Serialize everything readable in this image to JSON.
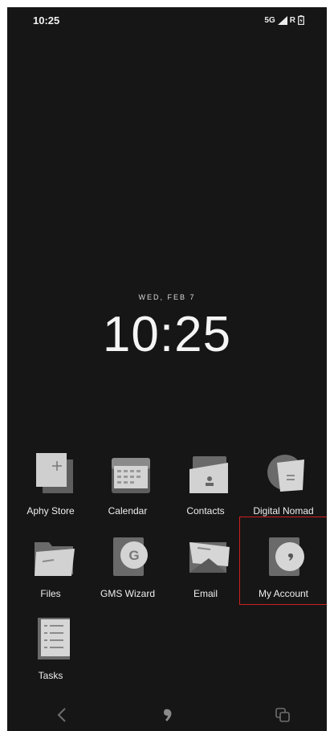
{
  "status_bar": {
    "time": "10:25",
    "network": "5G",
    "roaming": "R"
  },
  "clock": {
    "date": "WED, FEB 7",
    "time": "10:25"
  },
  "apps": [
    {
      "label": "Aphy Store",
      "icon": "aphy-store-icon"
    },
    {
      "label": "Calendar",
      "icon": "calendar-icon"
    },
    {
      "label": "Contacts",
      "icon": "contacts-icon"
    },
    {
      "label": "Digital Nomad",
      "icon": "digital-nomad-icon"
    },
    {
      "label": "Files",
      "icon": "folder-icon"
    },
    {
      "label": "GMS Wizard",
      "icon": "gms-wizard-icon"
    },
    {
      "label": "Email",
      "icon": "email-icon"
    },
    {
      "label": "My Account",
      "icon": "my-account-icon"
    },
    {
      "label": "Tasks",
      "icon": "tasks-icon"
    }
  ],
  "highlighted_app": "My Account",
  "colors": {
    "background": "#161616",
    "highlight": "#d01f1f"
  }
}
